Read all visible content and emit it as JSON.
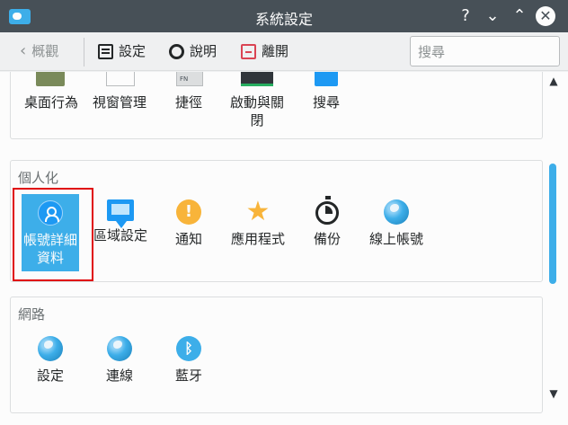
{
  "window": {
    "title": "系統設定",
    "help": "?",
    "minimize": "⌄",
    "maximize": "⌃",
    "close": "✕"
  },
  "toolbar": {
    "back_icon": "‹",
    "back_label": "概觀",
    "settings_label": "設定",
    "help_label": "說明",
    "quit_label": "離開"
  },
  "search": {
    "placeholder": "搜尋",
    "value": ""
  },
  "top_row": {
    "items": [
      {
        "label": "桌面行為",
        "icon": "desktop-behavior-icon"
      },
      {
        "label": "視窗管理",
        "icon": "window-management-icon"
      },
      {
        "label": "捷徑",
        "icon": "shortcuts-icon"
      },
      {
        "label": "啟動與關閉",
        "icon": "startup-shutdown-icon"
      },
      {
        "label": "搜尋",
        "icon": "search-icon"
      }
    ],
    "stub_fn_text": "FN"
  },
  "personal": {
    "title": "個人化",
    "items": [
      {
        "label": "帳號詳細資料",
        "icon": "user-account-icon",
        "selected": true
      },
      {
        "label": "區域設定",
        "icon": "locale-chat-icon"
      },
      {
        "label": "通知",
        "icon": "notification-icon",
        "glyph": "!"
      },
      {
        "label": "應用程式",
        "icon": "star-icon",
        "glyph": "★"
      },
      {
        "label": "備份",
        "icon": "backup-clock-icon"
      },
      {
        "label": "線上帳號",
        "icon": "globe-icon"
      }
    ]
  },
  "network": {
    "title": "網路",
    "items": [
      {
        "label": "設定",
        "icon": "globe-icon"
      },
      {
        "label": "連線",
        "icon": "globe-icon"
      },
      {
        "label": "藍牙",
        "icon": "bluetooth-icon",
        "glyph": "ᛒ"
      }
    ]
  },
  "scrollbar": {
    "up": "▲",
    "down": "▼"
  },
  "colors": {
    "accent": "#3daee9",
    "titlebar": "#475057",
    "highlight": "#e0070b"
  }
}
